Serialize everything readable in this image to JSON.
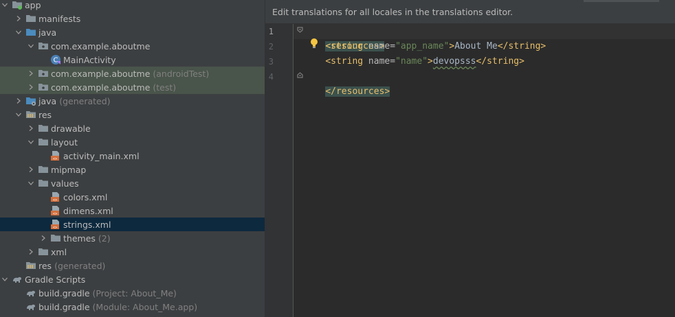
{
  "tree": {
    "items": [
      {
        "label": "app",
        "hint": "",
        "icon": "module-folder-icon",
        "depth": 0,
        "arrow": "down",
        "style": ""
      },
      {
        "label": "manifests",
        "hint": "",
        "icon": "folder-icon",
        "depth": 1,
        "arrow": "right",
        "style": ""
      },
      {
        "label": "java",
        "hint": "",
        "icon": "source-folder-icon",
        "depth": 1,
        "arrow": "down",
        "style": ""
      },
      {
        "label": "com.example.aboutme",
        "hint": "",
        "icon": "package-icon",
        "depth": 2,
        "arrow": "down",
        "style": ""
      },
      {
        "label": "MainActivity",
        "hint": "",
        "icon": "kotlin-class-icon",
        "depth": 3,
        "arrow": "none",
        "style": ""
      },
      {
        "label": "com.example.aboutme",
        "hint": "(androidTest)",
        "icon": "package-icon",
        "depth": 2,
        "arrow": "right",
        "style": "test-bg"
      },
      {
        "label": "com.example.aboutme",
        "hint": "(test)",
        "icon": "package-icon",
        "depth": 2,
        "arrow": "right",
        "style": "test-bg"
      },
      {
        "label": "java",
        "hint": "(generated)",
        "icon": "generated-folder-icon",
        "depth": 1,
        "arrow": "right",
        "style": ""
      },
      {
        "label": "res",
        "hint": "",
        "icon": "resource-folder-icon",
        "depth": 1,
        "arrow": "down",
        "style": ""
      },
      {
        "label": "drawable",
        "hint": "",
        "icon": "folder-icon",
        "depth": 2,
        "arrow": "right",
        "style": ""
      },
      {
        "label": "layout",
        "hint": "",
        "icon": "folder-icon",
        "depth": 2,
        "arrow": "down",
        "style": ""
      },
      {
        "label": "activity_main.xml",
        "hint": "",
        "icon": "xml-file-icon",
        "depth": 3,
        "arrow": "none",
        "style": ""
      },
      {
        "label": "mipmap",
        "hint": "",
        "icon": "folder-icon",
        "depth": 2,
        "arrow": "right",
        "style": ""
      },
      {
        "label": "values",
        "hint": "",
        "icon": "folder-icon",
        "depth": 2,
        "arrow": "down",
        "style": ""
      },
      {
        "label": "colors.xml",
        "hint": "",
        "icon": "xml-file-icon",
        "depth": 3,
        "arrow": "none",
        "style": ""
      },
      {
        "label": "dimens.xml",
        "hint": "",
        "icon": "xml-file-icon",
        "depth": 3,
        "arrow": "none",
        "style": ""
      },
      {
        "label": "strings.xml",
        "hint": "",
        "icon": "xml-file-icon",
        "depth": 3,
        "arrow": "none",
        "style": "selected"
      },
      {
        "label": "themes",
        "hint": "(2)",
        "icon": "folder-icon",
        "depth": 3,
        "arrow": "right",
        "style": ""
      },
      {
        "label": "xml",
        "hint": "",
        "icon": "folder-icon",
        "depth": 2,
        "arrow": "right",
        "style": ""
      },
      {
        "label": "res",
        "hint": "(generated)",
        "icon": "resource-folder-icon",
        "depth": 1,
        "arrow": "none",
        "style": ""
      },
      {
        "label": "Gradle Scripts",
        "hint": "",
        "icon": "gradle-icon",
        "depth": 0,
        "arrow": "down",
        "style": ""
      },
      {
        "label": "build.gradle",
        "hint": "(Project: About_Me)",
        "icon": "gradle-icon",
        "depth": 1,
        "arrow": "none",
        "style": ""
      },
      {
        "label": "build.gradle",
        "hint": "(Module: About_Me.app)",
        "icon": "gradle-icon",
        "depth": 1,
        "arrow": "none",
        "style": ""
      }
    ]
  },
  "editor": {
    "banner": "Edit translations for all locales in the translations editor.",
    "line_numbers": [
      "1",
      "2",
      "3",
      "4"
    ],
    "lines": [
      {
        "indent": "",
        "open_tag": "<resources>",
        "attr": "",
        "value": "",
        "text": "",
        "close_tag": ""
      },
      {
        "indent": "    ",
        "open_tag": "<string",
        "attr": " name=",
        "value": "\"app_name\"",
        "tag_end": ">",
        "text": "About Me",
        "close_tag": "</string>"
      },
      {
        "indent": "    ",
        "open_tag": "<string",
        "attr": " name=",
        "value": "\"name\"",
        "tag_end": ">",
        "text": "devopsss",
        "close_tag": "</string>"
      },
      {
        "indent": "",
        "open_tag": "</resources>",
        "attr": "",
        "value": "",
        "text": "",
        "close_tag": ""
      }
    ]
  },
  "colors": {
    "tree_bg": "#3c3f41",
    "editor_bg": "#2b2b2b",
    "selection": "#0d293e",
    "test_highlight": "#49544a",
    "xml_tag": "#e8bf6a",
    "xml_value": "#6a8759"
  }
}
